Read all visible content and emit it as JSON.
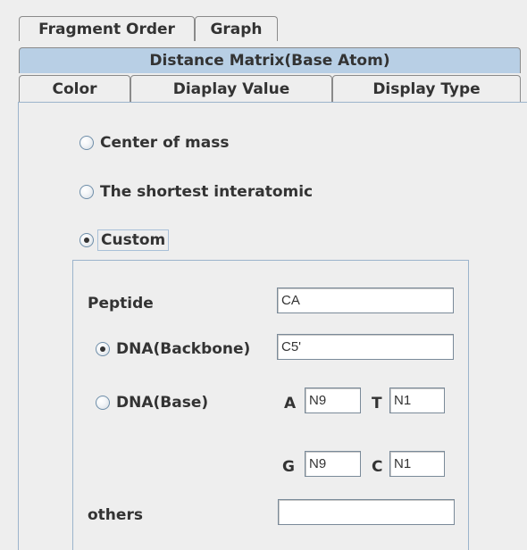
{
  "tabs": {
    "row1": [
      "Fragment Order",
      "Graph"
    ],
    "row2": [
      "Distance Matrix(Base Atom)"
    ],
    "row3": [
      "Color",
      "Diaplay Value",
      "Display Type"
    ]
  },
  "selected_tab": "Distance Matrix(Base Atom)",
  "distance_method": {
    "options": [
      {
        "label": "Center of mass",
        "checked": false
      },
      {
        "label": "The shortest interatomic",
        "checked": false
      },
      {
        "label": "Custom",
        "checked": true
      }
    ]
  },
  "custom": {
    "peptide": {
      "label": "Peptide",
      "value": "CA"
    },
    "dna_backbone": {
      "label": "DNA(Backbone)",
      "value": "C5'",
      "checked": true
    },
    "dna_base": {
      "label": "DNA(Base)",
      "checked": false,
      "A": {
        "label": "A",
        "value": "N9"
      },
      "T": {
        "label": "T",
        "value": "N1"
      },
      "G": {
        "label": "G",
        "value": "N9"
      },
      "C": {
        "label": "C",
        "value": "N1"
      }
    },
    "others": {
      "label": "others",
      "value": ""
    }
  },
  "colors": {
    "selected_tab": "#b8cfe5",
    "panel_border": "#9cb4cc",
    "background": "#eeeeee"
  }
}
